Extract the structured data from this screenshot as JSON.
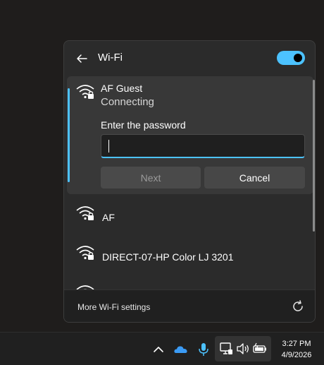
{
  "flyout": {
    "title": "Wi-Fi",
    "wifi_toggle": "on",
    "footer_link": "More Wi-Fi settings"
  },
  "selected_network": {
    "name": "AF Guest",
    "status": "Connecting",
    "password_label": "Enter the password",
    "password_value": "",
    "next_label": "Next",
    "cancel_label": "Cancel"
  },
  "networks": [
    {
      "name": "AF",
      "secured": true
    },
    {
      "name": "DIRECT-07-HP Color LJ 3201",
      "secured": true
    },
    {
      "name": "",
      "secured": true
    }
  ],
  "taskbar": {
    "time": "3:27 PM",
    "date": "4/9/2026",
    "icons": [
      "chevron-up-icon",
      "onedrive-icon",
      "microphone-icon",
      "network-icon",
      "volume-icon",
      "battery-icon"
    ]
  },
  "colors": {
    "accent": "#4cc2ff",
    "panel": "#2b2b2b",
    "selected": "#383838"
  }
}
